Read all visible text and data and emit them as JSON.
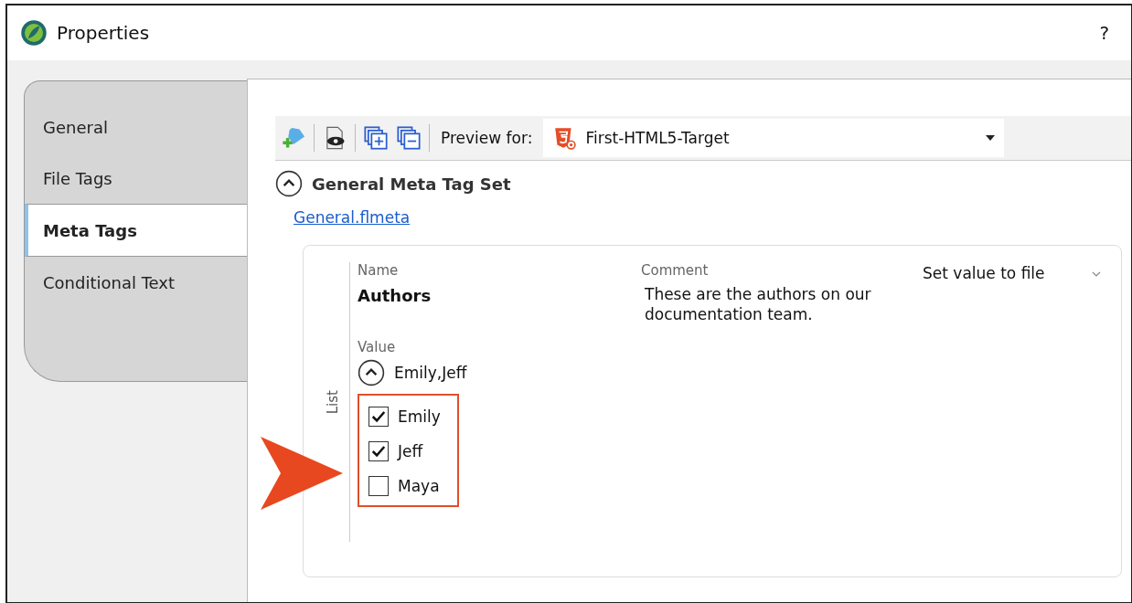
{
  "window": {
    "title": "Properties",
    "help": "?"
  },
  "tabs": [
    {
      "label": "General",
      "selected": false
    },
    {
      "label": "File Tags",
      "selected": false
    },
    {
      "label": "Meta Tags",
      "selected": true
    },
    {
      "label": "Conditional Text",
      "selected": false
    }
  ],
  "toolbar": {
    "preview_label": "Preview for:",
    "target": "First-HTML5-Target"
  },
  "section": {
    "title": "General Meta Tag Set",
    "expanded": true,
    "link": "General.flmeta"
  },
  "meta_tag": {
    "group_label": "List",
    "name_label": "Name",
    "name": "Authors",
    "comment_label": "Comment",
    "comment": "These are the authors on our documentation team.",
    "action": "Set value to file",
    "value_label": "Value",
    "value": "Emily,Jeff",
    "expanded": true,
    "options": [
      {
        "label": "Emily",
        "checked": true
      },
      {
        "label": "Jeff",
        "checked": true
      },
      {
        "label": "Maya",
        "checked": false
      }
    ]
  }
}
